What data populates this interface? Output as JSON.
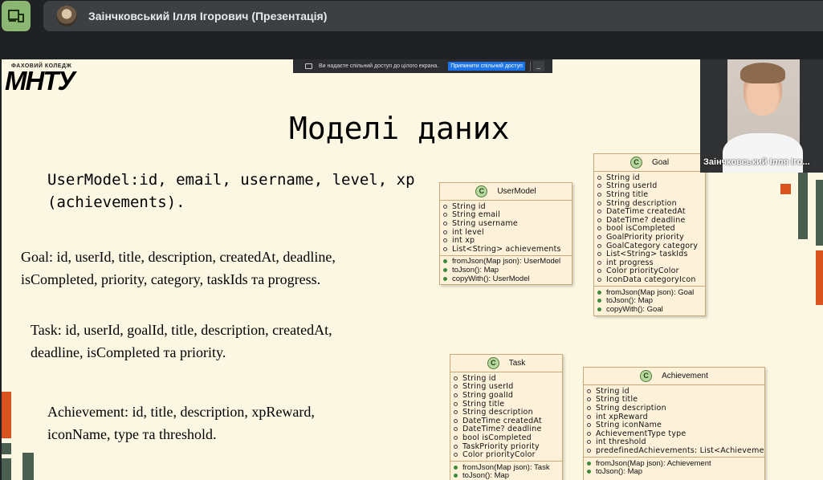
{
  "meeting": {
    "presenter_title": "Заінчковський Ілля Ігорович (Презентація)",
    "self_view_name": "Заінчковський Ілля Іго..."
  },
  "share_bar": {
    "message": "Ви надаєте спільний доступ до цілого екрана.",
    "stop_label": "Припинити спільний доступ",
    "hide_label": "_"
  },
  "slide": {
    "logo_sub": "ФАХОВИЙ КОЛЕДЖ",
    "logo_main": "МНТУ",
    "title": "Моделі даних",
    "usermodel_text": "UserModel:id, email, username, level, xp (achievements).",
    "goal_text": "Goal: id, userId, title, description, createdAt, deadline, isCompleted, priority, category, taskIds та progress.",
    "task_text": "Task: id, userId, goalId, title, description, createdAt, deadline, isCompleted та priority.",
    "achievement_text": "Achievement: id, title, description, xpReward, iconName, type та threshold."
  },
  "uml": {
    "usermodel": {
      "name": "UserModel",
      "fields": [
        "String id",
        "String email",
        "String username",
        "int level",
        "int xp",
        "List<String> achievements"
      ],
      "methods": [
        "fromJson(Map json): UserModel",
        "toJson(): Map",
        "copyWith(): UserModel"
      ]
    },
    "goal": {
      "name": "Goal",
      "fields": [
        "String id",
        "String userId",
        "String title",
        "String description",
        "DateTime createdAt",
        "DateTime? deadline",
        "bool isCompleted",
        "GoalPriority priority",
        "GoalCategory category",
        "List<String> taskIds",
        "int progress",
        "Color priorityColor",
        "IconData categoryIcon"
      ],
      "methods": [
        "fromJson(Map json): Goal",
        "toJson(): Map",
        "copyWith(): Goal"
      ]
    },
    "task": {
      "name": "Task",
      "fields": [
        "String id",
        "String userId",
        "String goalId",
        "String title",
        "String description",
        "DateTime createdAt",
        "DateTime? deadline",
        "bool isCompleted",
        "TaskPriority priority",
        "Color priorityColor"
      ],
      "methods": [
        "fromJson(Map json): Task",
        "toJson(): Map"
      ]
    },
    "achievement": {
      "name": "Achievement",
      "fields": [
        "String id",
        "String title",
        "String description",
        "int xpReward",
        "String iconName",
        "AchievementType type",
        "int threshold",
        "predefinedAchievements: List<Achievement>"
      ],
      "methods": [
        "fromJson(Map json): Achievement",
        "toJson(): Map"
      ]
    }
  },
  "colors": {
    "accent_orange": "#d9531e",
    "accent_green": "#4a5f51",
    "uml_fill": "#fdf1d9",
    "meet_layout_green": "#8ab772"
  },
  "icons": {
    "layout": "layout-icon",
    "class_marker": "class-c-icon"
  }
}
